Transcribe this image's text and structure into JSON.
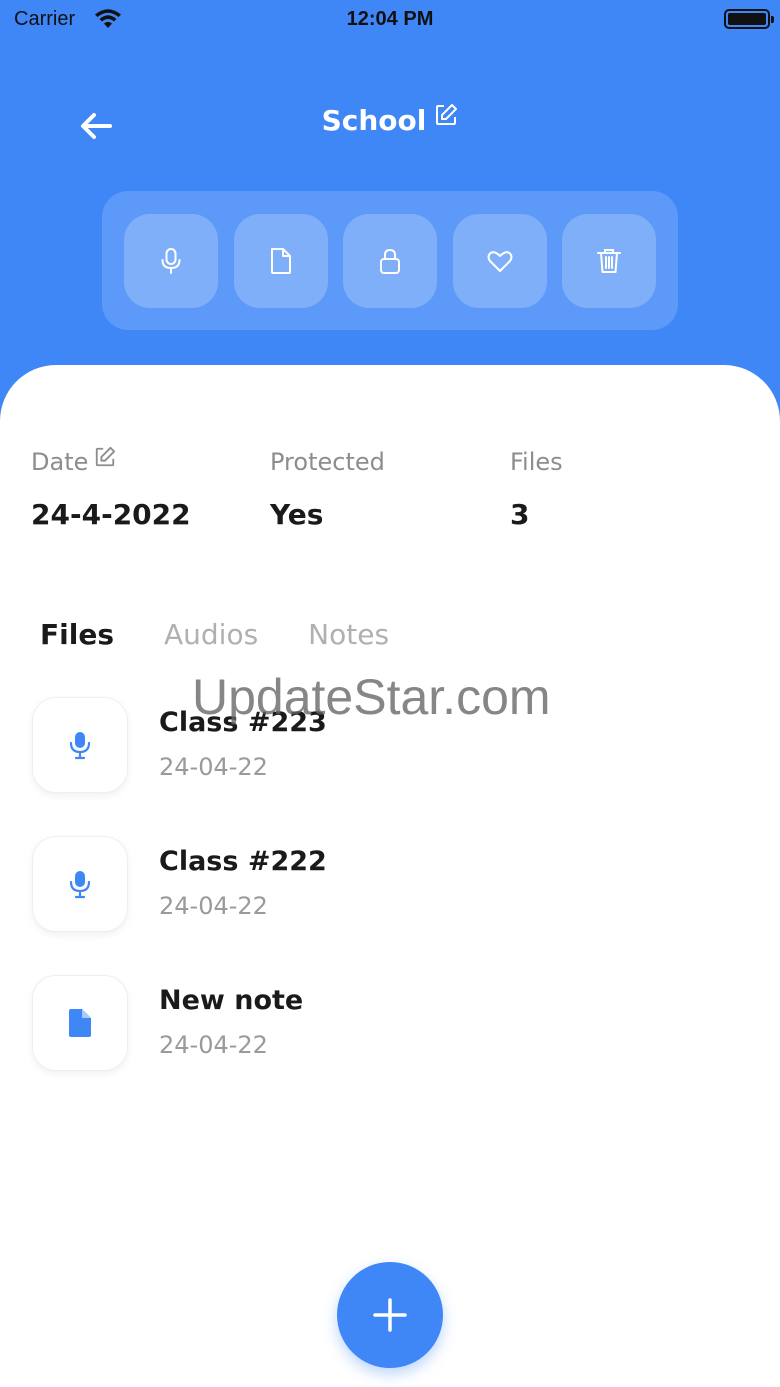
{
  "status_bar": {
    "carrier": "Carrier",
    "time": "12:04 PM"
  },
  "header": {
    "title": "School"
  },
  "actions": [
    {
      "icon": "microphone-icon"
    },
    {
      "icon": "document-icon"
    },
    {
      "icon": "lock-icon"
    },
    {
      "icon": "heart-icon"
    },
    {
      "icon": "trash-icon"
    }
  ],
  "info": {
    "date_label": "Date",
    "date_value": "24-4-2022",
    "protected_label": "Protected",
    "protected_value": "Yes",
    "files_label": "Files",
    "files_value": "3"
  },
  "tabs": [
    {
      "label": "Files",
      "active": true
    },
    {
      "label": "Audios",
      "active": false
    },
    {
      "label": "Notes",
      "active": false
    }
  ],
  "files": [
    {
      "name": "Class #223",
      "date": "24-04-22",
      "icon": "microphone-icon"
    },
    {
      "name": "Class #222",
      "date": "24-04-22",
      "icon": "microphone-icon"
    },
    {
      "name": "New note",
      "date": "24-04-22",
      "icon": "document-icon"
    }
  ],
  "watermark": "UpdateStar.com",
  "colors": {
    "primary": "#3f86f7",
    "text": "#1a1a1a",
    "muted": "#9a9a9a"
  }
}
